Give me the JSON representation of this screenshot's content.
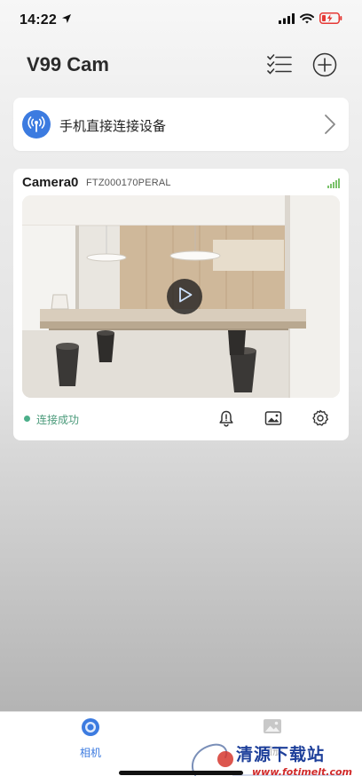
{
  "status_bar": {
    "time": "14:22",
    "location_icon": "location-arrow-icon",
    "signal_icon": "cellular-signal-icon",
    "wifi_icon": "wifi-icon",
    "battery_icon": "battery-charging-low-icon",
    "battery_color": "#e53935"
  },
  "header": {
    "title": "V99 Cam",
    "list_icon": "checklist-icon",
    "add_icon": "plus-circle-icon"
  },
  "direct_connect": {
    "label": "手机直接连接设备",
    "icon": "broadcast-antenna-icon",
    "accent": "#3c7be0"
  },
  "camera": {
    "name": "Camera0",
    "device_id": "FTZ000170PERAL",
    "status": "连接成功",
    "status_color": "#4caf8a",
    "signal_color": "#7ac26a",
    "signal_bars": 4
  },
  "tabs": [
    {
      "label": "相机",
      "icon": "camera-lens-icon",
      "active": true
    },
    {
      "label": "相册",
      "icon": "photo-album-icon",
      "active": false
    }
  ],
  "watermark": {
    "text": "清源下载站",
    "url": "www.fotimelt.com"
  }
}
